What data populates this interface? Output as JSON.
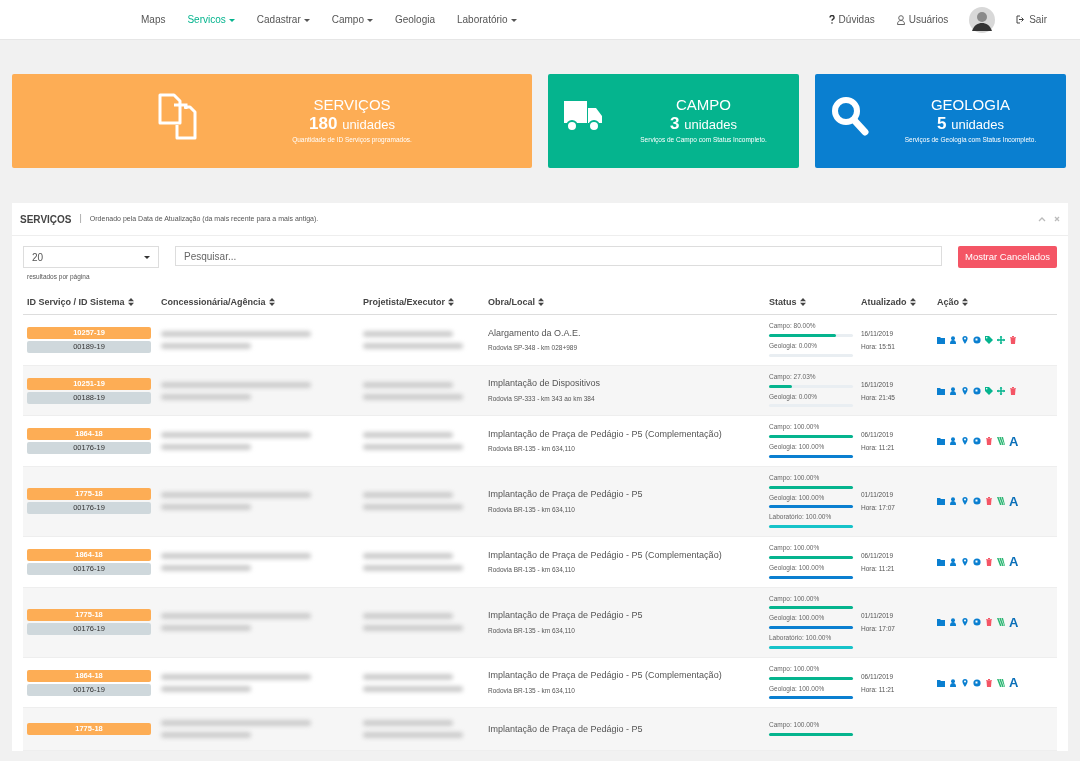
{
  "nav": {
    "items": [
      {
        "label": "Maps",
        "selected": false,
        "dropdown": false
      },
      {
        "label": "Servicos",
        "selected": true,
        "dropdown": true
      },
      {
        "label": "Cadastrar",
        "selected": false,
        "dropdown": true
      },
      {
        "label": "Campo",
        "selected": false,
        "dropdown": true
      },
      {
        "label": "Geologia",
        "selected": false,
        "dropdown": false
      },
      {
        "label": "Laboratório",
        "selected": false,
        "dropdown": true
      }
    ],
    "right": [
      {
        "kind": "help",
        "label": "Dúvidas"
      },
      {
        "kind": "users",
        "label": "Usuários"
      },
      {
        "kind": "avatar"
      },
      {
        "kind": "logout",
        "label": "Sair"
      }
    ]
  },
  "stats": [
    {
      "kind": "servicos",
      "title": "SERVIÇOS",
      "count": "180",
      "unit": "unidades",
      "description": "Quantidade de ID Serviços programados."
    },
    {
      "kind": "campo",
      "title": "CAMPO",
      "count": "3",
      "unit": "unidades",
      "description": "Serviços de Campo com Status Incompleto."
    },
    {
      "kind": "geologia",
      "title": "GEOLOGIA",
      "count": "5",
      "unit": "unidades",
      "description": "Serviços de Geologia com Status Incompleto."
    }
  ],
  "panel": {
    "title": "SERVIÇOS",
    "separator": "|",
    "subtitle": "Ordenado pela Data de Atualização (da mais recente para a mais antiga).",
    "page_size": "20",
    "page_size_hint": "resultados por página",
    "search": {
      "placeholder": "Pesquisar..."
    },
    "cancel_button": "Mostrar Cancelados",
    "columns": [
      "ID Serviço / ID Sistema",
      "Concessionária/Agência",
      "Projetista/Executor",
      "Obra/Local",
      "Status",
      "Atualizado",
      "Ação"
    ],
    "rows": [
      {
        "id_servico": "10257-19",
        "id_sistema": "00189-19",
        "obra": "Alargamento da O.A.E.",
        "local": "Rodovia SP-348 - km 028+989",
        "status": [
          {
            "kind": "campo",
            "label": "Campo: 80.00%",
            "level": 0.8
          },
          {
            "kind": "geologia",
            "label": "Geologia: 0.00%",
            "level": 0
          }
        ],
        "date": "16/11/2019",
        "time": "Hora: 15:51",
        "actions": [
          {
            "kind": "folder"
          },
          {
            "kind": "user"
          },
          {
            "kind": "pin"
          },
          {
            "kind": "globe"
          },
          {
            "kind": "tag"
          },
          {
            "kind": "move"
          },
          {
            "kind": "trash"
          }
        ]
      },
      {
        "id_servico": "10251-19",
        "id_sistema": "00188-19",
        "obra": "Implantação de Dispositivos",
        "local": "Rodovia SP-333 - km 343 ao km 384",
        "status": [
          {
            "kind": "campo",
            "label": "Campo: 27.03%",
            "level": 0.27
          },
          {
            "kind": "geologia",
            "label": "Geologia: 0.00%",
            "level": 0
          }
        ],
        "date": "16/11/2019",
        "time": "Hora: 21:45",
        "actions": [
          {
            "kind": "folder"
          },
          {
            "kind": "user"
          },
          {
            "kind": "pin"
          },
          {
            "kind": "globe"
          },
          {
            "kind": "tag"
          },
          {
            "kind": "move"
          },
          {
            "kind": "trash"
          }
        ]
      },
      {
        "id_servico": "1864-18",
        "id_sistema": "00176-19",
        "obra": "Implantação de Praça de Pedágio - P5 (Complementação)",
        "local": "Rodovia BR-135 - km 634,110",
        "status": [
          {
            "kind": "campo",
            "label": "Campo: 100.00%",
            "level": 1
          },
          {
            "kind": "geologia",
            "label": "Geologia: 100.00%",
            "level": 1
          }
        ],
        "date": "06/11/2019",
        "time": "Hora: 11:21",
        "actions": [
          {
            "kind": "folder"
          },
          {
            "kind": "user"
          },
          {
            "kind": "pin"
          },
          {
            "kind": "globe"
          },
          {
            "kind": "trash"
          },
          {
            "kind": "stripes"
          },
          {
            "kind": "letter",
            "text": "A"
          }
        ]
      },
      {
        "id_servico": "1775-18",
        "id_sistema": "00176-19",
        "obra": "Implantação de Praça de Pedágio - P5",
        "local": "Rodovia BR-135 - km 634,110",
        "status": [
          {
            "kind": "campo",
            "label": "Campo: 100.00%",
            "level": 1
          },
          {
            "kind": "geologia",
            "label": "Geologia: 100.00%",
            "level": 1
          },
          {
            "kind": "laboratorio",
            "label": "Laboratório: 100.00%",
            "level": 1
          }
        ],
        "date": "01/11/2019",
        "time": "Hora: 17:07",
        "actions": [
          {
            "kind": "folder"
          },
          {
            "kind": "user"
          },
          {
            "kind": "pin"
          },
          {
            "kind": "globe"
          },
          {
            "kind": "trash"
          },
          {
            "kind": "stripes"
          },
          {
            "kind": "letter",
            "text": "A"
          }
        ]
      },
      {
        "id_servico": "1864-18",
        "id_sistema": "00176-19",
        "obra": "Implantação de Praça de Pedágio - P5 (Complementação)",
        "local": "Rodovia BR-135 - km 634,110",
        "status": [
          {
            "kind": "campo",
            "label": "Campo: 100.00%",
            "level": 1
          },
          {
            "kind": "geologia",
            "label": "Geologia: 100.00%",
            "level": 1
          }
        ],
        "date": "06/11/2019",
        "time": "Hora: 11:21",
        "actions": [
          {
            "kind": "folder"
          },
          {
            "kind": "user"
          },
          {
            "kind": "pin"
          },
          {
            "kind": "globe"
          },
          {
            "kind": "trash"
          },
          {
            "kind": "stripes"
          },
          {
            "kind": "letter",
            "text": "A"
          }
        ]
      },
      {
        "id_servico": "1775-18",
        "id_sistema": "00176-19",
        "obra": "Implantação de Praça de Pedágio - P5",
        "local": "Rodovia BR-135 - km 634,110",
        "status": [
          {
            "kind": "campo",
            "label": "Campo: 100.00%",
            "level": 1
          },
          {
            "kind": "geologia",
            "label": "Geologia: 100.00%",
            "level": 1
          },
          {
            "kind": "laboratorio",
            "label": "Laboratório: 100.00%",
            "level": 1
          }
        ],
        "date": "01/11/2019",
        "time": "Hora: 17:07",
        "actions": [
          {
            "kind": "folder"
          },
          {
            "kind": "user"
          },
          {
            "kind": "pin"
          },
          {
            "kind": "globe"
          },
          {
            "kind": "trash"
          },
          {
            "kind": "stripes"
          },
          {
            "kind": "letter",
            "text": "A"
          }
        ]
      },
      {
        "id_servico": "1864-18",
        "id_sistema": "00176-19",
        "obra": "Implantação de Praça de Pedágio - P5 (Complementação)",
        "local": "Rodovia BR-135 - km 634,110",
        "status": [
          {
            "kind": "campo",
            "label": "Campo: 100.00%",
            "level": 1
          },
          {
            "kind": "geologia",
            "label": "Geologia: 100.00%",
            "level": 1
          }
        ],
        "date": "06/11/2019",
        "time": "Hora: 11:21",
        "actions": [
          {
            "kind": "folder"
          },
          {
            "kind": "user"
          },
          {
            "kind": "pin"
          },
          {
            "kind": "globe"
          },
          {
            "kind": "trash"
          },
          {
            "kind": "stripes"
          },
          {
            "kind": "letter",
            "text": "A"
          }
        ]
      },
      {
        "id_servico": "1775-18",
        "obra": "Implantação de Praça de Pedágio - P5",
        "status": [
          {
            "kind": "campo",
            "label": "Campo: 100.00%",
            "level": 1
          }
        ]
      }
    ]
  }
}
